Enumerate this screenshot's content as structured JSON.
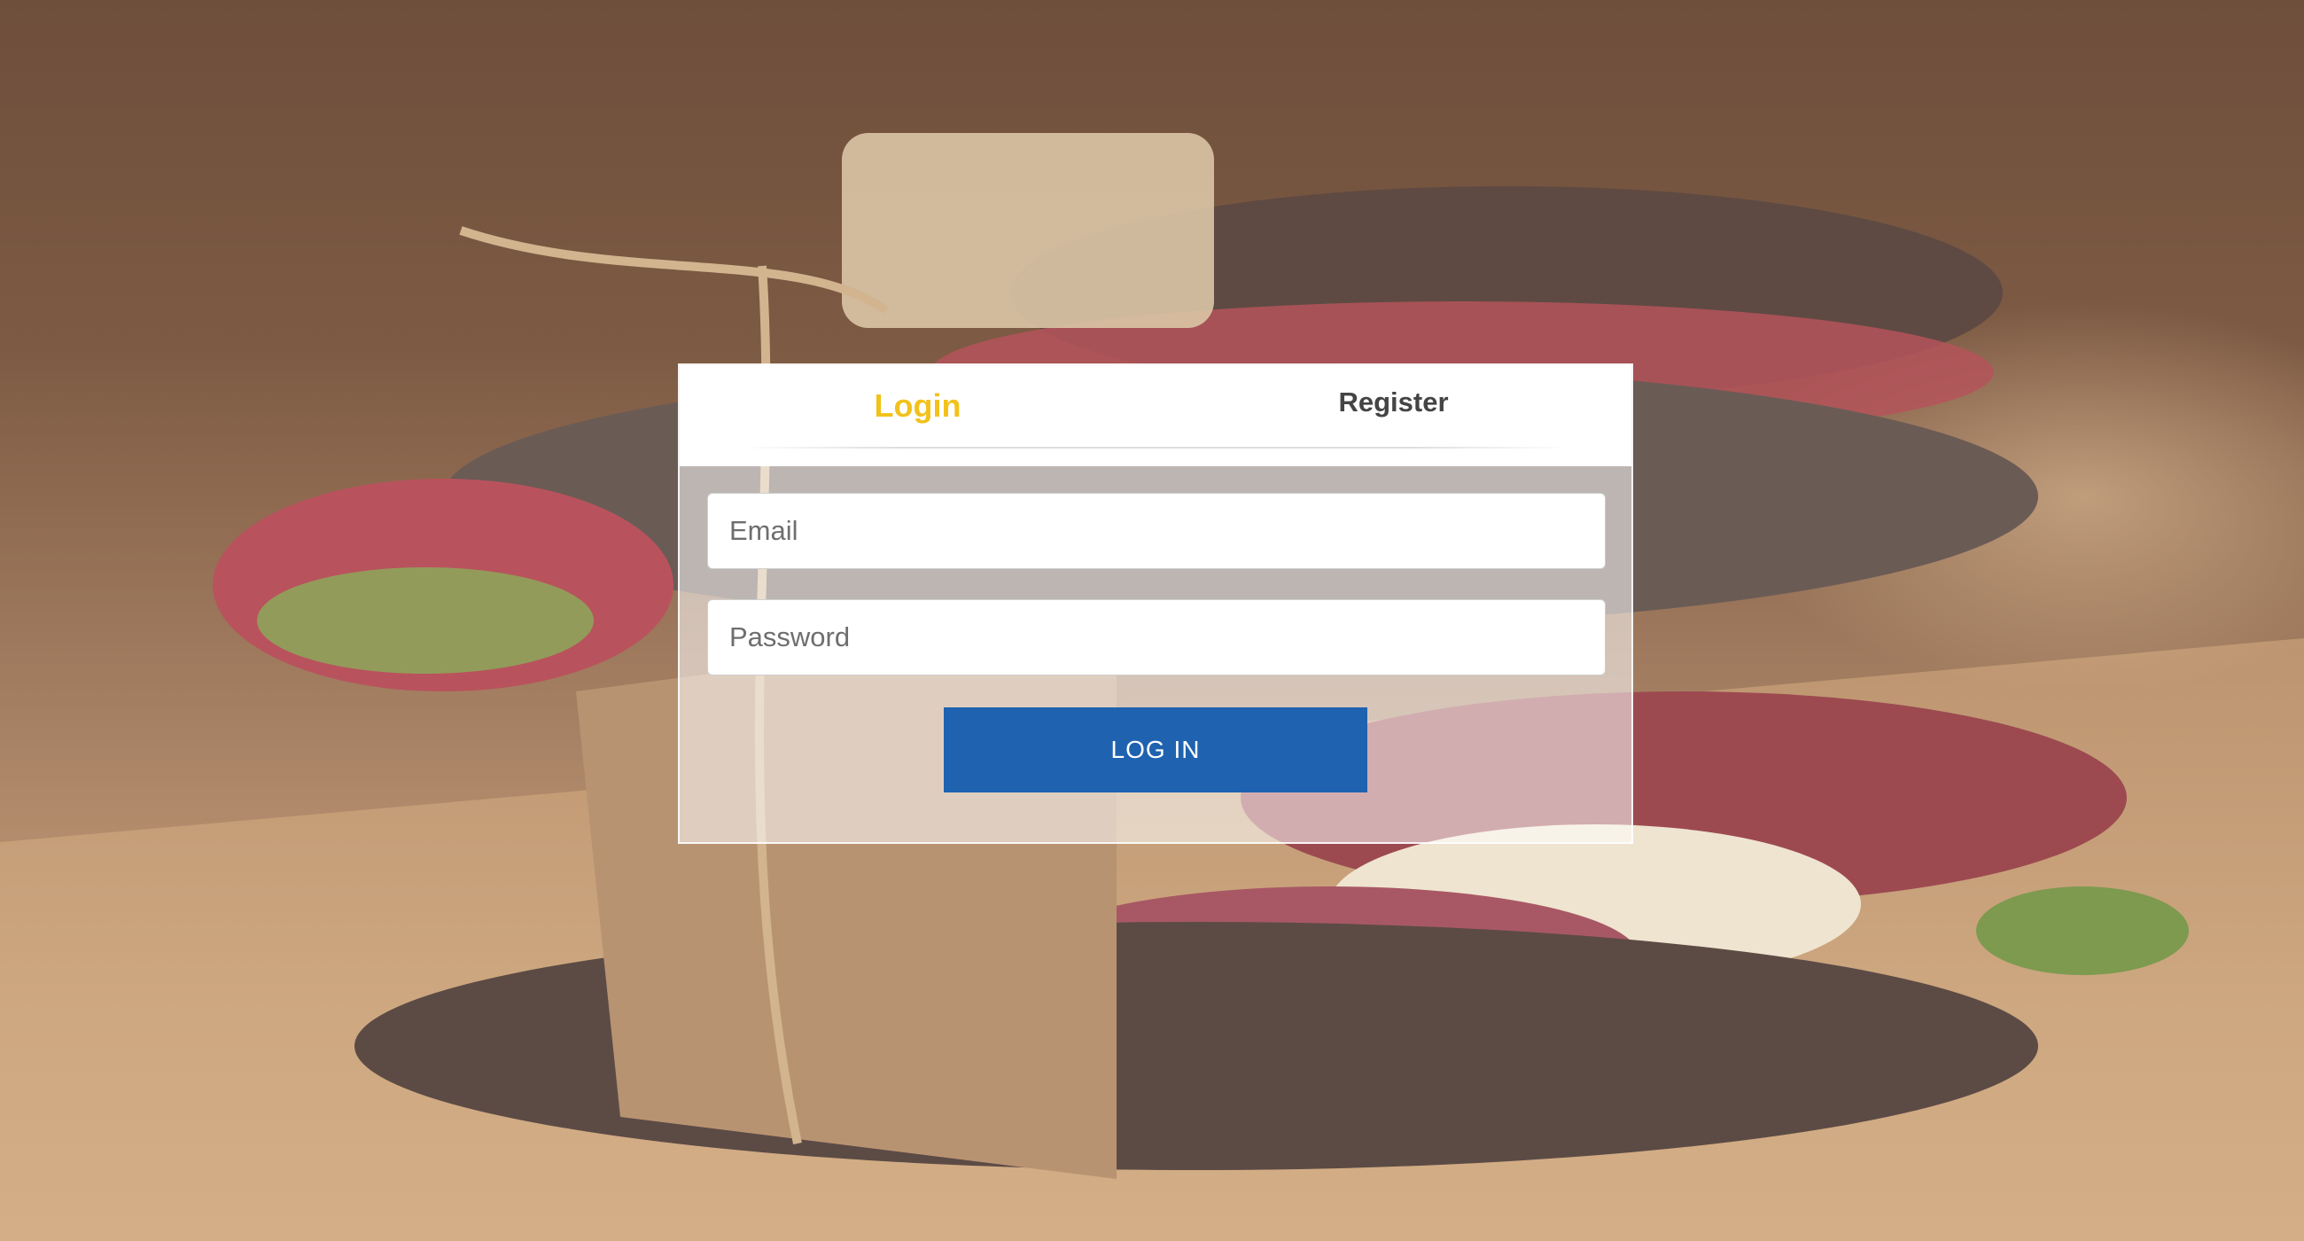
{
  "tabs": {
    "login_label": "Login",
    "register_label": "Register",
    "active": "login"
  },
  "form": {
    "email_placeholder": "Email",
    "password_placeholder": "Password",
    "submit_label": "LOG IN"
  },
  "colors": {
    "active_tab": "#f2c21b",
    "inactive_tab": "#444444",
    "button": "#1f63b0",
    "button_text": "#ffffff"
  },
  "background": {
    "subject": "sandwich-photo"
  }
}
